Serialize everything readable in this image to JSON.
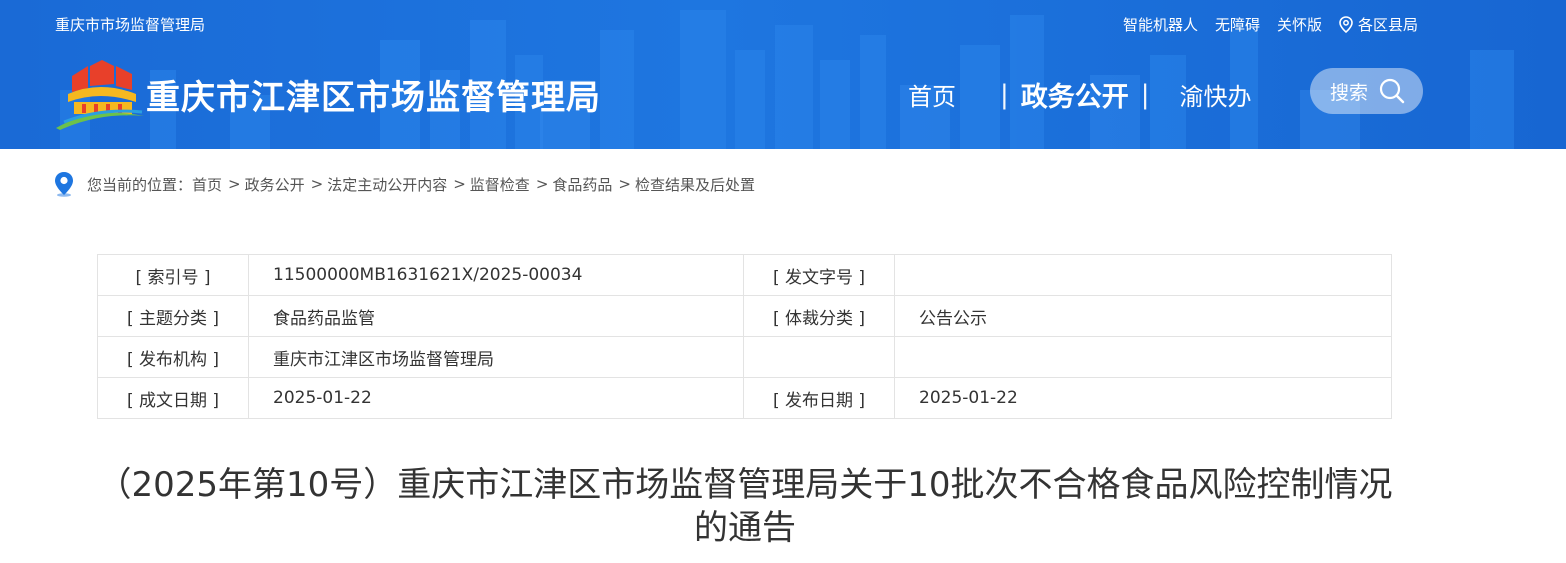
{
  "header": {
    "site_name_top": "重庆市市场监督管理局",
    "top_links": {
      "robot": "智能机器人",
      "accessible": "无障碍",
      "care": "关怀版",
      "region": "各区县局"
    },
    "title": "重庆市江津区市场监督管理局",
    "nav": {
      "home": "首页",
      "gov": "政务公开",
      "yukuaiban": "渝快办"
    },
    "search_label": "搜索"
  },
  "breadcrumb": {
    "prefix": "您当前的位置：",
    "items": [
      "首页",
      "政务公开",
      "法定主动公开内容",
      "监督检查",
      "食品药品",
      "检查结果及后处置"
    ],
    "separator": ">"
  },
  "info": {
    "rows": [
      {
        "k1": "[ 索引号 ]",
        "v1": "11500000MB1631621X/2025-00034",
        "k2": "[ 发文字号 ]",
        "v2": ""
      },
      {
        "k1": "[ 主题分类 ]",
        "v1": "食品药品监管",
        "k2": "[ 体裁分类 ]",
        "v2": "公告公示"
      },
      {
        "k1": "[ 发布机构 ]",
        "v1": "重庆市江津区市场监督管理局",
        "k2": "",
        "v2": ""
      },
      {
        "k1": "[ 成文日期 ]",
        "v1": "2025-01-22",
        "k2": "[ 发布日期 ]",
        "v2": "2025-01-22"
      }
    ]
  },
  "article": {
    "title": "（2025年第10号）重庆市江津区市场监督管理局关于10批次不合格食品风险控制情况的通告"
  },
  "colors": {
    "header_blue": "#1e76e0",
    "logo_red": "#e8402a",
    "logo_yellow": "#f5b820",
    "logo_green": "#6cc24a"
  }
}
